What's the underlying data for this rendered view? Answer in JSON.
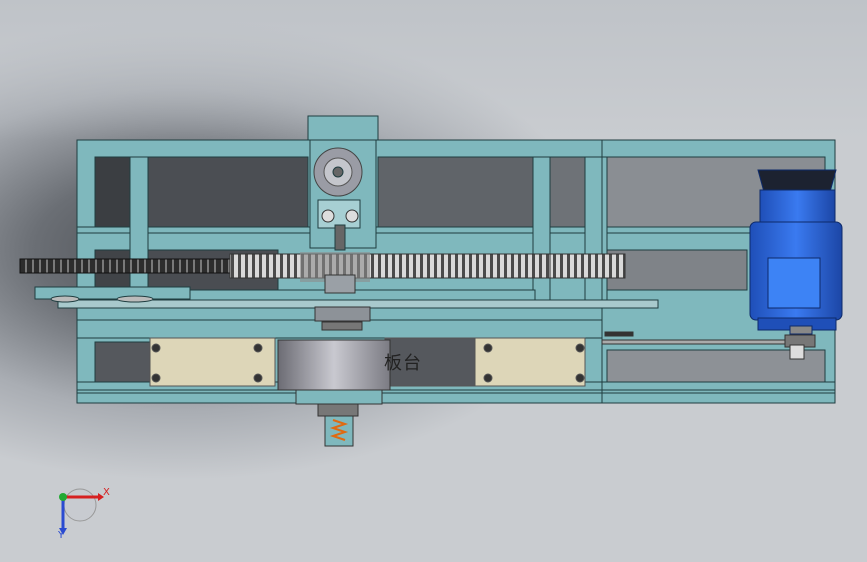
{
  "viewport": {
    "background_colors": [
      "#4a4d52",
      "#a9adb3",
      "#c9ccd0"
    ]
  },
  "model": {
    "frame_color": "#7fb8bd",
    "frame_edge_color": "#1f3d40",
    "motor_color": "#2563d9",
    "block_color": "#ddd6b8",
    "gear_color": "#9a9a9a",
    "part_label": "板台"
  },
  "triad": {
    "x_label": "X",
    "y_label": "Y",
    "x_color": "#d62020",
    "y_color": "#2a4bd1",
    "origin_color": "#22aa33"
  }
}
